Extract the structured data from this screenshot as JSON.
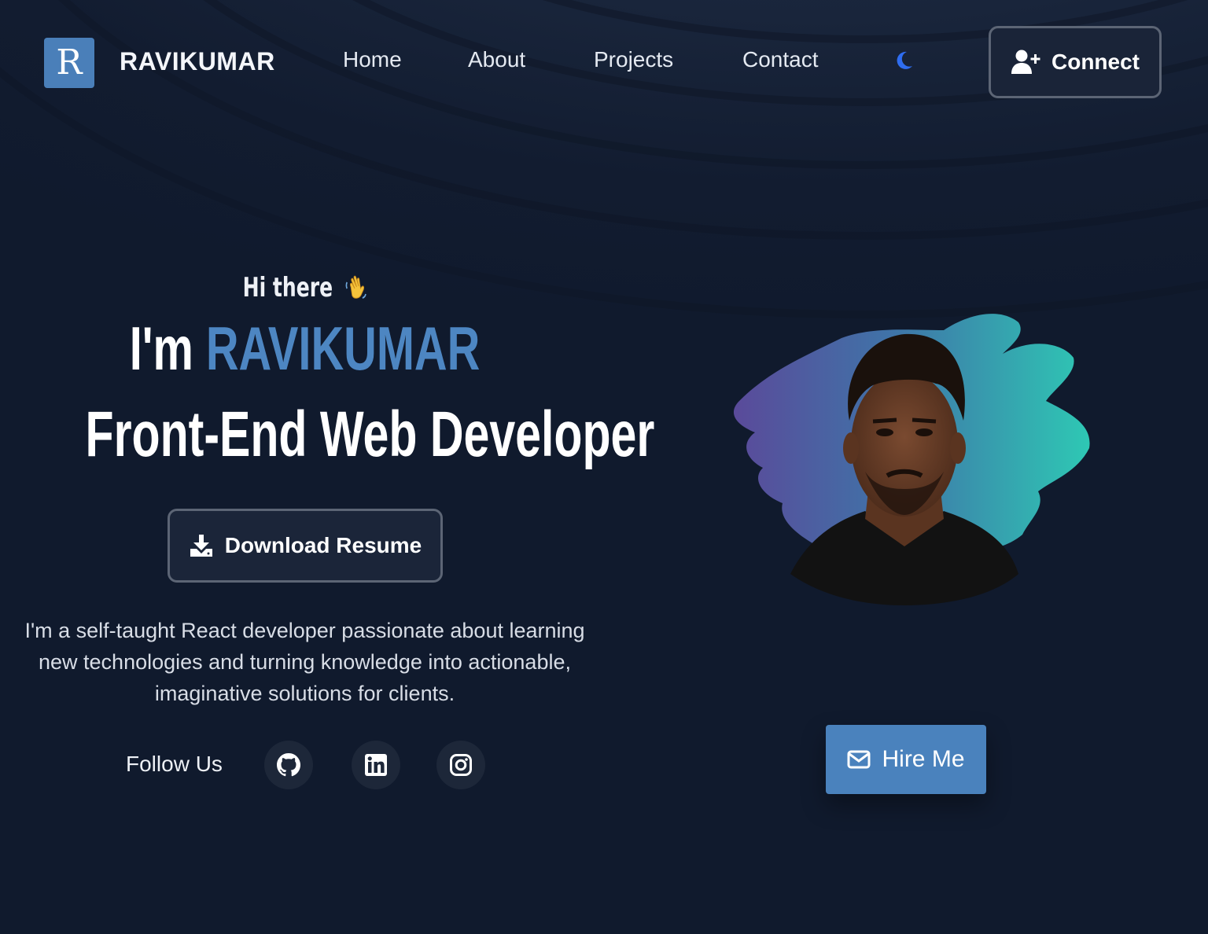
{
  "nav": {
    "logo_letter": "R",
    "brand": "RAVIKUMAR",
    "links": [
      "Home",
      "About",
      "Projects",
      "Contact"
    ],
    "theme_toggle_icon": "moon-icon",
    "connect_label": "Connect",
    "connect_icon": "user-plus-icon"
  },
  "hero": {
    "greeting": "Hi there",
    "greeting_emoji_icon": "waving-hand-icon",
    "intro_prefix": "I'm",
    "name": "RAVIKUMAR",
    "role": "Front-End Web Developer",
    "download_label": "Download Resume",
    "download_icon": "download-icon",
    "bio": "I'm a self-taught React developer passionate about learning new technologies and turning knowledge into actionable, imaginative solutions for clients.",
    "follow_label": "Follow Us",
    "socials": [
      "github-icon",
      "linkedin-icon",
      "instagram-icon"
    ],
    "hire_label": "Hire Me",
    "hire_icon": "envelope-icon"
  },
  "colors": {
    "background": "#101a2d",
    "accent": "#4a82bd",
    "name_highlight": "#4d86c2",
    "moon": "#2f6df0",
    "blob_start": "#5a4a9a",
    "blob_end": "#2ec8b4"
  }
}
